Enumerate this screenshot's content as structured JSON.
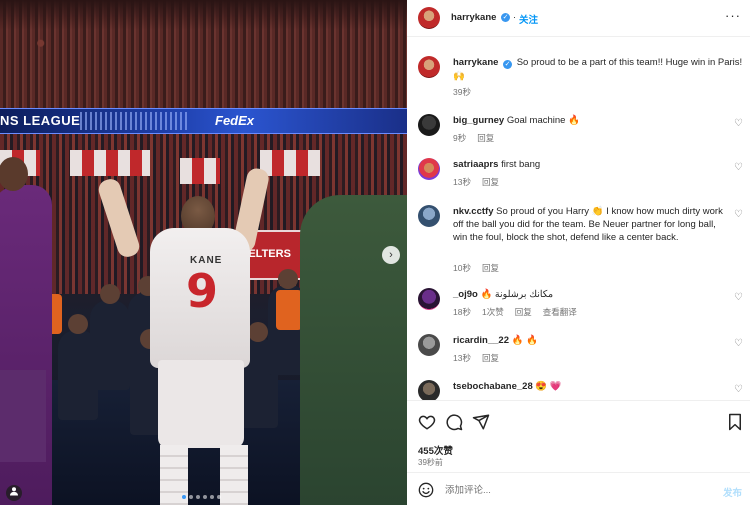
{
  "photo": {
    "led_left": "NS LEAGUE",
    "led_right": "FedEx",
    "banner_text": "SELTERS",
    "player_name": "KANE",
    "player_number": "9",
    "carousel_count": 6,
    "carousel_active": 0
  },
  "header": {
    "username": "harrykane",
    "dot": "·",
    "follow_label": "关注",
    "more_label": "···"
  },
  "caption": {
    "username": "harrykane",
    "text": "So proud to be a part of this team!! Huge win in Paris! 🙌",
    "time": "39秒"
  },
  "comments": [
    {
      "username": "big_gurney",
      "text": "Goal machine 🔥",
      "time": "9秒",
      "reply": "回复",
      "likes": "",
      "translate": ""
    },
    {
      "username": "satriaaprs",
      "text": "first bang",
      "time": "13秒",
      "reply": "回复",
      "likes": "",
      "translate": ""
    },
    {
      "username": "nkv.cctfy",
      "text": "So proud of you Harry 👏 I know how much dirty work off the ball you did for the team. Be Neuer partner for long ball, win the foul, block the shot, defend like a center back.",
      "time": "10秒",
      "reply": "回复",
      "likes": "",
      "translate": ""
    },
    {
      "username": "_oj9o",
      "text": "🔥 مكانك برشلونة",
      "time": "18秒",
      "reply": "回复",
      "likes": "1次赞",
      "translate": "查看翻译"
    },
    {
      "username": "ricardin__22",
      "text": "🔥 🔥",
      "time": "13秒",
      "reply": "回复",
      "likes": "",
      "translate": ""
    },
    {
      "username": "tsebochabane_28",
      "text": "😍 💗",
      "time": "",
      "reply": "",
      "likes": "",
      "translate": ""
    }
  ],
  "actions": {
    "likes": "455次赞",
    "time": "39秒前"
  },
  "add_comment": {
    "placeholder": "添加评论...",
    "post_label": "发布"
  },
  "colors": {
    "accent": "#0095f6",
    "muted": "#737373",
    "verified": "#3897f0"
  }
}
